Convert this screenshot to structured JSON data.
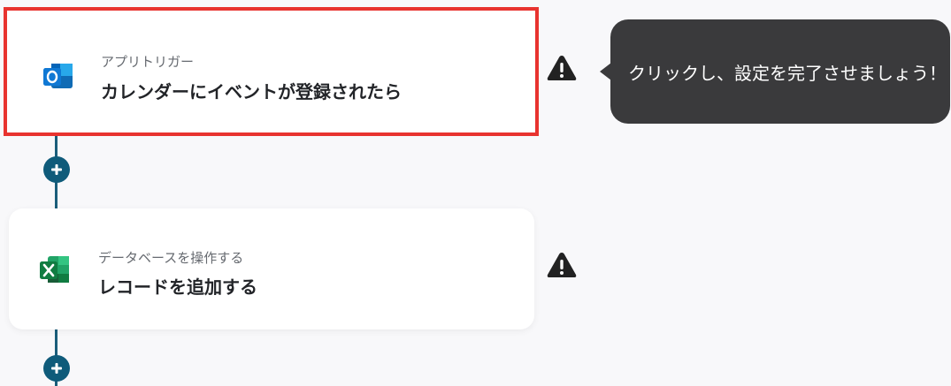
{
  "flow": {
    "steps": [
      {
        "app": "outlook",
        "app_icon": "outlook-icon",
        "subtitle": "アプリトリガー",
        "title": "カレンダーにイベントが登録されたら",
        "selected": true
      },
      {
        "app": "excel",
        "app_icon": "excel-icon",
        "subtitle": "データベースを操作する",
        "title": "レコードを追加する",
        "selected": false
      }
    ],
    "tooltip": "クリックし、設定を完了させましょう！"
  },
  "colors": {
    "selected_border": "#e8332f",
    "connector": "#1a5d7a",
    "add_button": "#0f5b7a",
    "tooltip_bg": "#3a3a3c",
    "warning": "#222222"
  }
}
